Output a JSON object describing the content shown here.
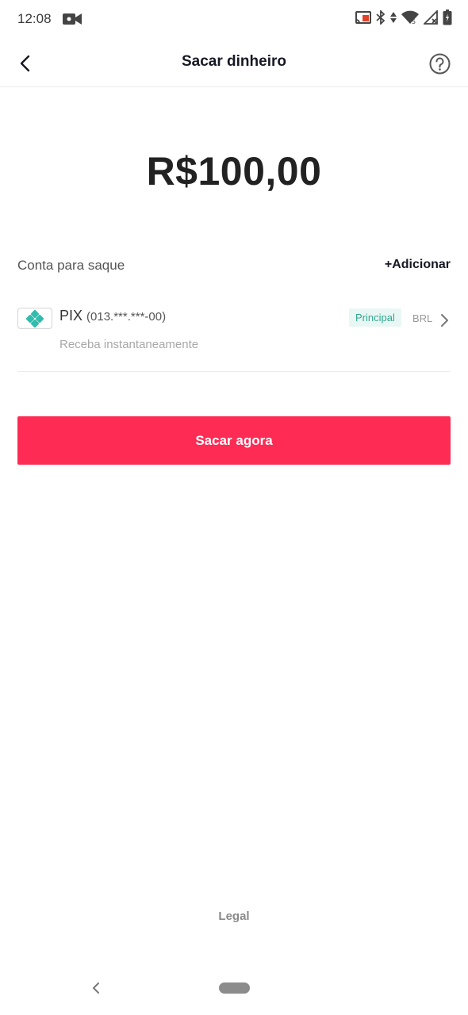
{
  "status_bar": {
    "time": "12:08",
    "icons": [
      "video-camera-icon",
      "cast-icon",
      "bluetooth-icon",
      "data-arrows-icon",
      "wifi-icon",
      "signal-icon",
      "battery-icon"
    ]
  },
  "header": {
    "title": "Sacar dinheiro",
    "back_icon": "chevron-left-icon",
    "help_icon": "question-circle-icon"
  },
  "amount": "R$100,00",
  "withdraw_account": {
    "label": "Conta para saque",
    "add_label": "+Adicionar",
    "method": {
      "name": "PIX",
      "masked_id": "(013.***.***-00)",
      "subtitle": "Receba instantaneamente",
      "badge": "Principal",
      "currency": "BRL"
    }
  },
  "cta": {
    "label": "Sacar agora"
  },
  "footer": {
    "legal": "Legal"
  },
  "colors": {
    "accent": "#fe2c55",
    "pix_green": "#32bcad",
    "badge_bg": "#e8f7f3",
    "badge_text": "#31a68f"
  }
}
